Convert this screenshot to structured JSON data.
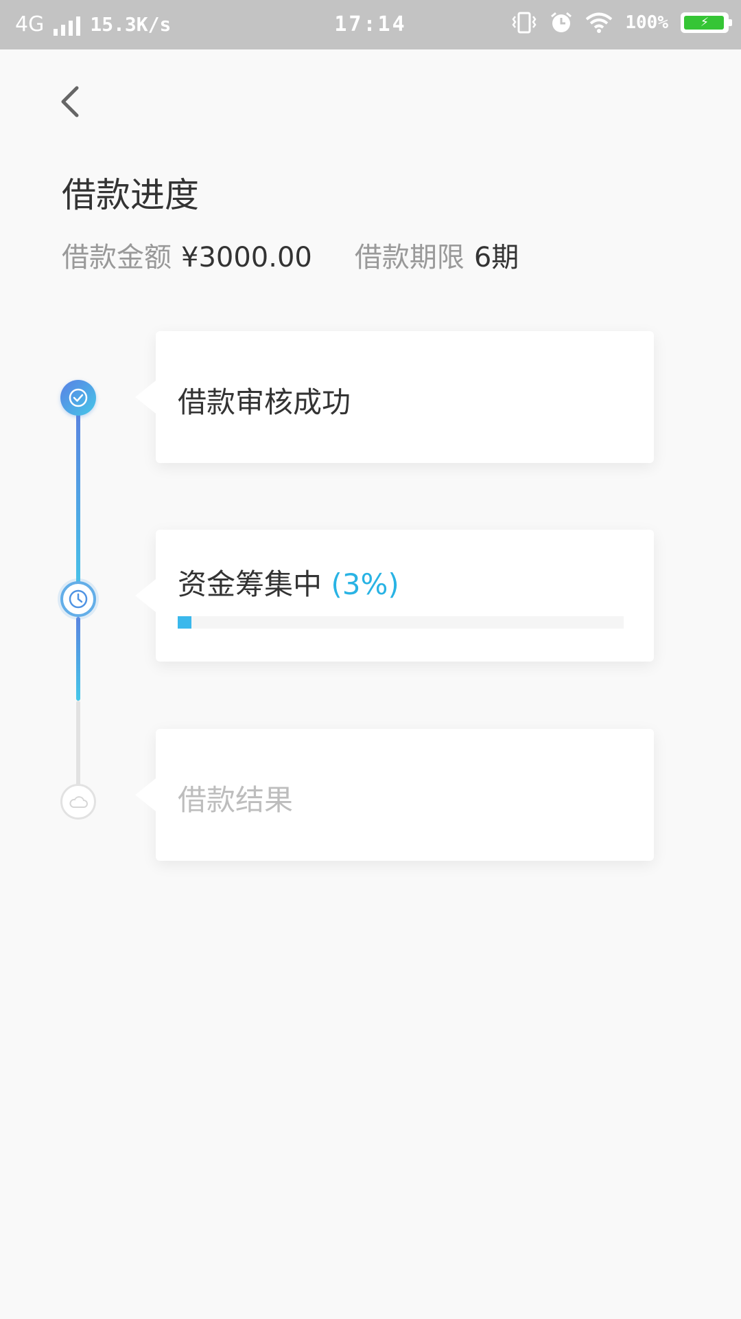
{
  "status_bar": {
    "network": "4G",
    "speed": "15.3K/s",
    "time": "17:14",
    "battery": "100%"
  },
  "header": {
    "title": "借款进度",
    "amount_label": "借款金额",
    "amount_value": "¥3000.00",
    "term_label": "借款期限",
    "term_value": "6期"
  },
  "steps": [
    {
      "title": "借款审核成功",
      "state": "done",
      "icon": "check-icon"
    },
    {
      "title": "资金筹集中",
      "percent_text": "(3%)",
      "progress": 0.03,
      "state": "active",
      "icon": "clock-icon"
    },
    {
      "title": "借款结果",
      "state": "pending",
      "icon": "cloud-icon"
    }
  ],
  "colors": {
    "accent": "#29b3e4",
    "gradient_start": "#5a80e4",
    "gradient_end": "#45c7e8",
    "inactive": "#e2e2e2"
  }
}
